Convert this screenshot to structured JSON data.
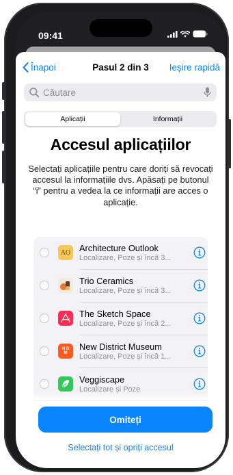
{
  "status": {
    "time": "09:41"
  },
  "nav": {
    "back_label": "Înapoi",
    "title": "Pasul 2 din 3",
    "quick_exit_label": "Ieșire rapidă"
  },
  "search": {
    "placeholder": "Căutare"
  },
  "segments": [
    {
      "label": "Aplicații",
      "selected": true
    },
    {
      "label": "Informații",
      "selected": false
    }
  ],
  "heading": "Accesul aplicațiilor",
  "description": "Selectați aplicațiile pentru care doriți să revocați accesul la informațiile dvs. Apăsați pe butonul “i” pentru a vedea la ce informații are acces o aplicație.",
  "apps": [
    {
      "name": "Architecture Outlook",
      "subtitle": "Localizare, Poze și încă 3...",
      "icon": "architecture-outlook-icon",
      "icon_text": "AO",
      "icon_color": "#f7c85a"
    },
    {
      "name": "Trio Ceramics",
      "subtitle": "Localizare, Poze și încă 3...",
      "icon": "trio-ceramics-icon",
      "icon_color": "#f3e9dc"
    },
    {
      "name": "The Sketch Space",
      "subtitle": "Localizare, Poze și încă 2...",
      "icon": "sketch-space-icon",
      "icon_color": "#ff2d55"
    },
    {
      "name": "New District Museum",
      "subtitle": "Localizare, Poze și încă 1...",
      "icon": "new-district-museum-icon",
      "icon_text": "N D M",
      "icon_color": "#ff5a1f"
    },
    {
      "name": "Veggiscape",
      "subtitle": "Localizare și Poze",
      "icon": "veggiscape-icon",
      "icon_color": "#34c759"
    }
  ],
  "colors": {
    "accent": "#0a84ff",
    "list_bg": "#f2f2f7"
  },
  "buttons": {
    "skip_label": "Omiteți",
    "select_all_label": "Selectați tot și opriți accesul"
  }
}
